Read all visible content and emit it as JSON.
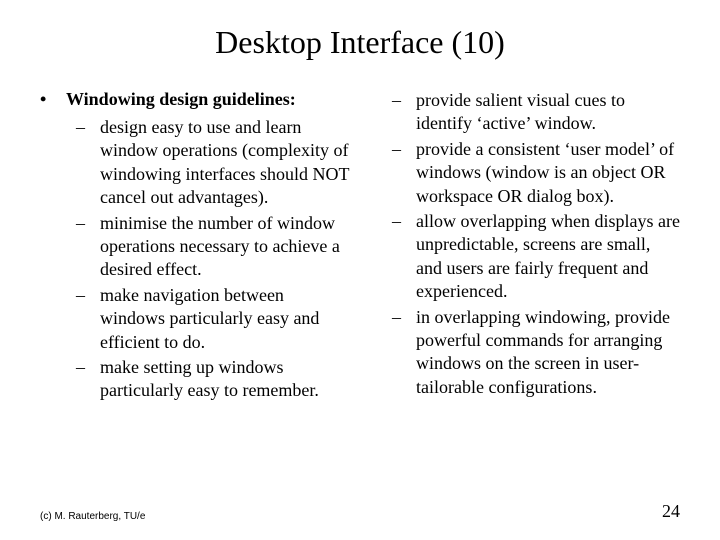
{
  "title": "Desktop Interface (10)",
  "heading": "Windowing design guidelines:",
  "left_items": [
    "design easy to use and learn window operations (complexity of windowing interfaces should NOT cancel out advantages).",
    "minimise the number of window operations necessary to achieve a desired effect.",
    "make navigation between windows particularly easy and efficient to do.",
    "make setting up windows particularly easy to remember."
  ],
  "right_items": [
    "provide salient visual cues to identify ‘active’ window.",
    "provide a consistent ‘user model’ of windows (window is an object OR workspace OR dialog box).",
    "allow overlapping when displays are unpredictable, screens are small, and users are fairly frequent and experienced.",
    "in overlapping windowing, provide powerful commands for arranging windows on the screen in user-tailorable configurations."
  ],
  "copyright": "(c) M. Rauterberg, TU/e",
  "page_number": "24",
  "bullet_char": "•",
  "dash_char": "–"
}
